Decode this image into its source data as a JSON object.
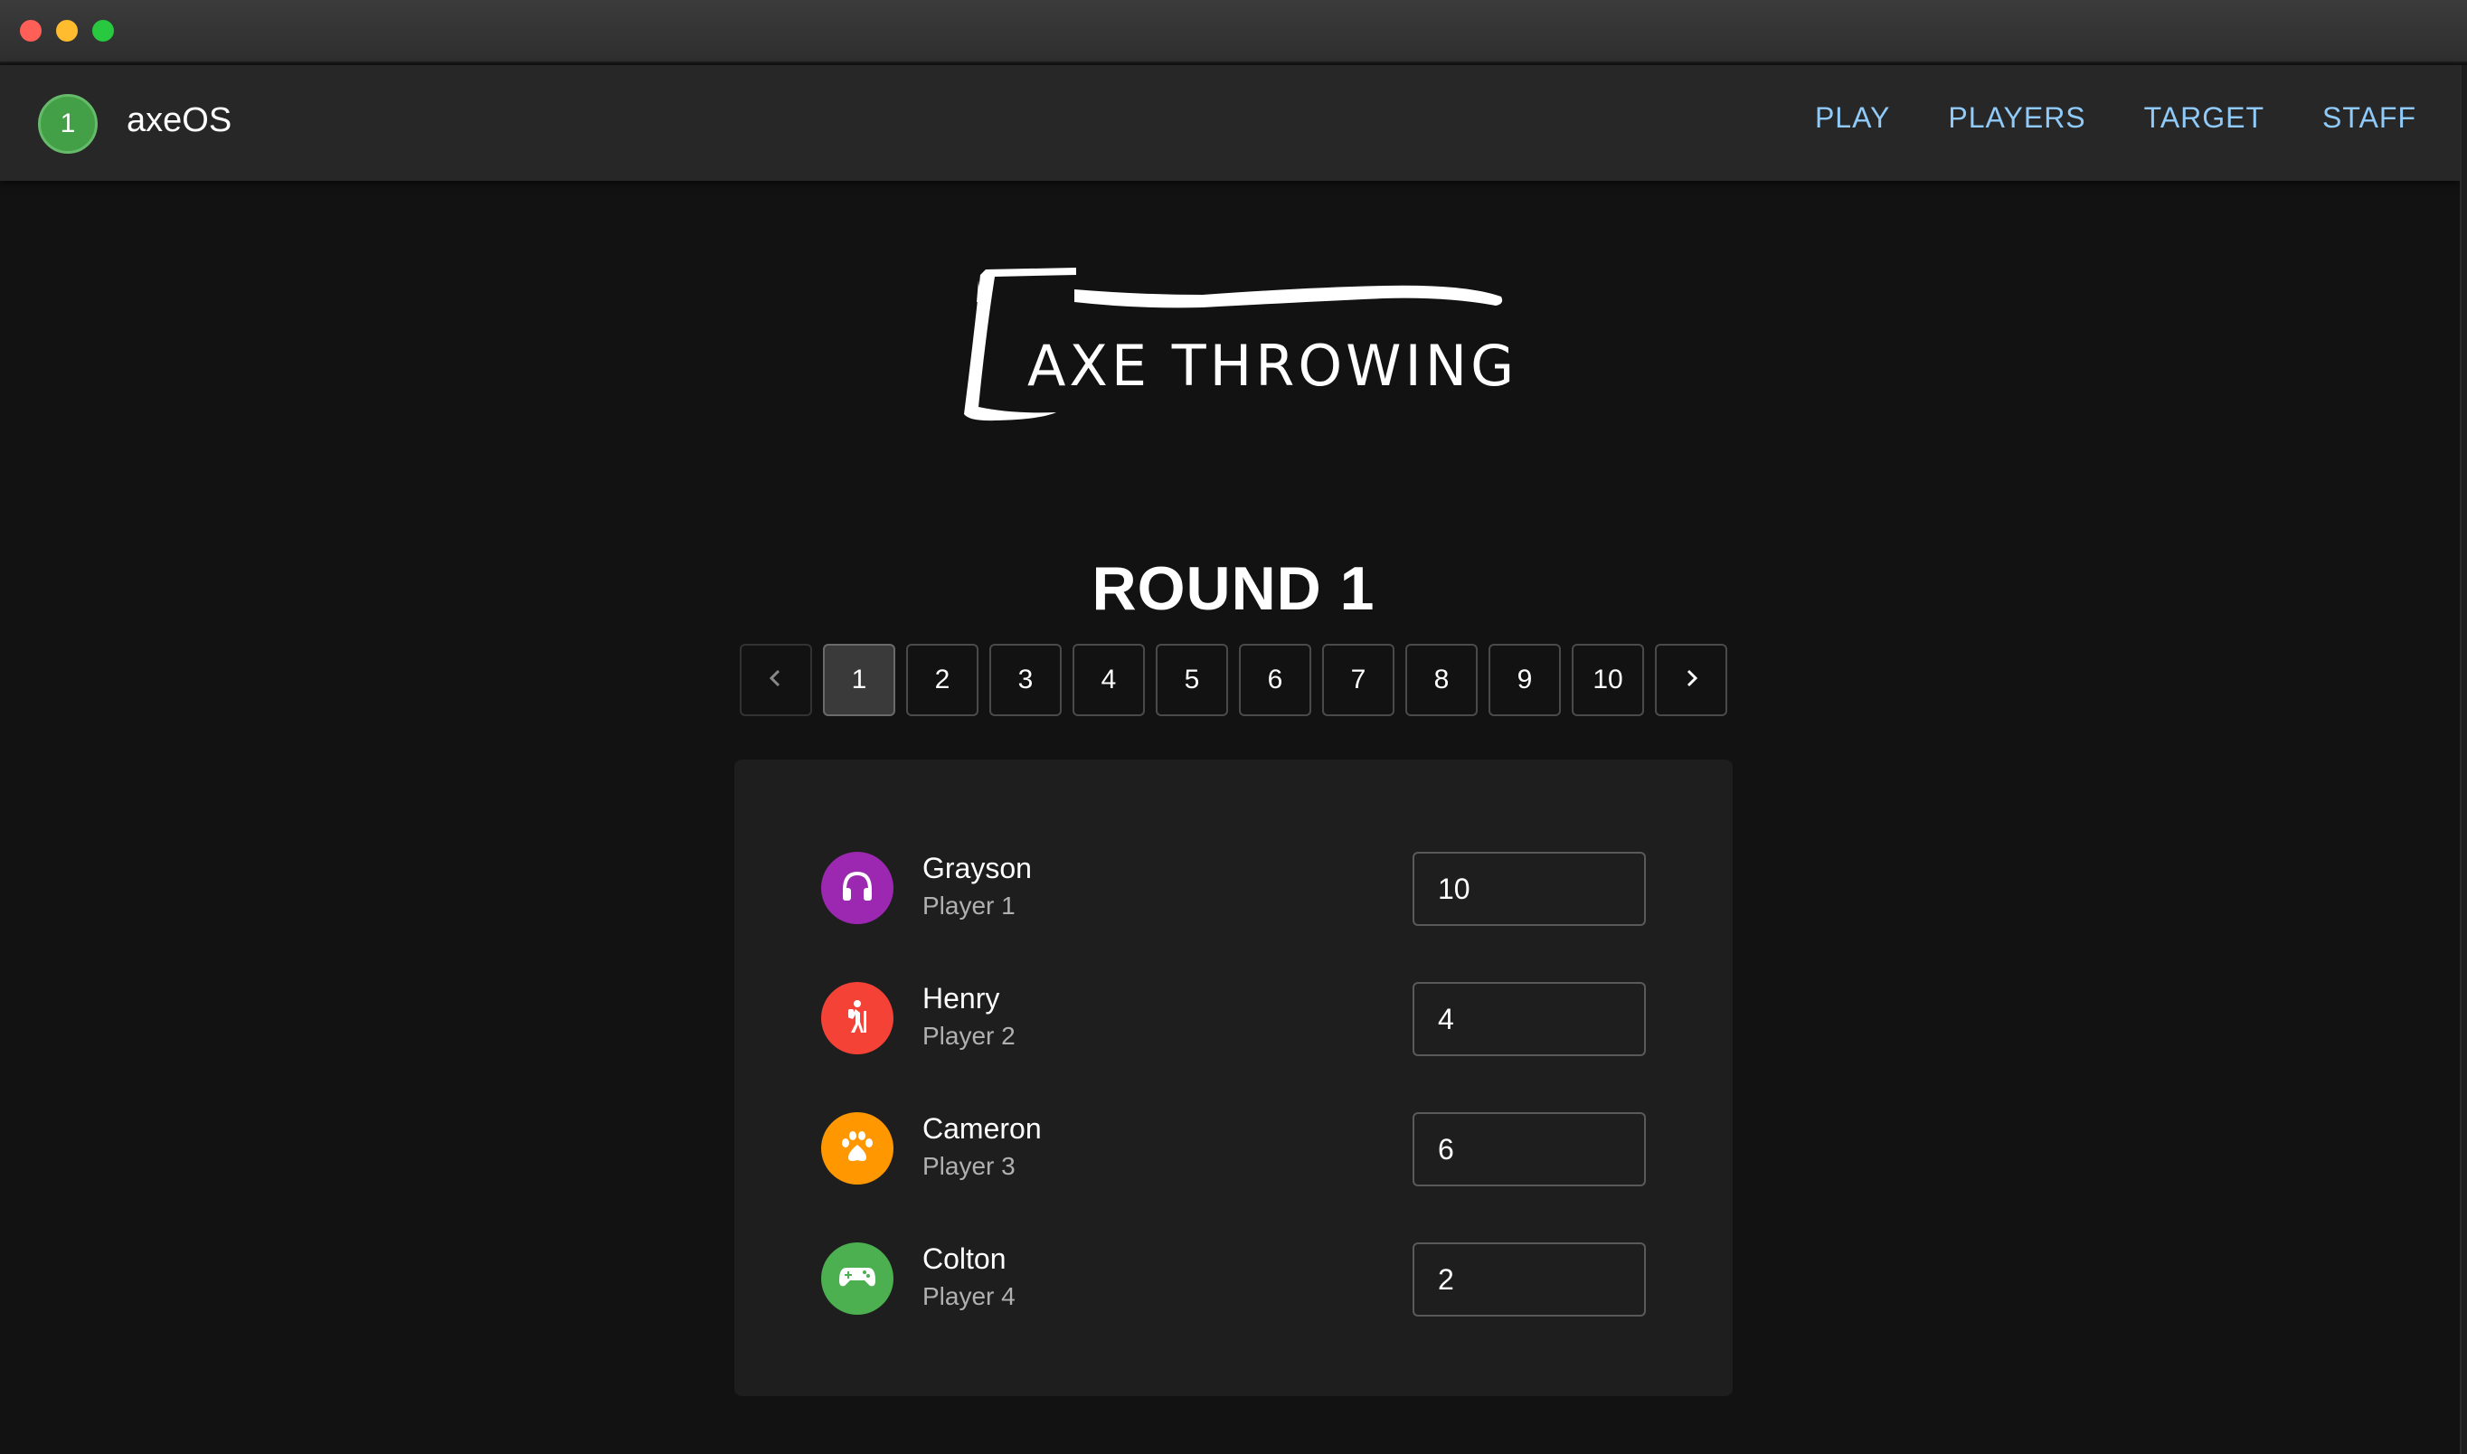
{
  "app": {
    "badge": "1",
    "title": "axeOS"
  },
  "nav": [
    {
      "label": "PLAY"
    },
    {
      "label": "PLAYERS"
    },
    {
      "label": "TARGET"
    },
    {
      "label": "STAFF"
    }
  ],
  "logo": {
    "text": "AXE THROWING"
  },
  "round": {
    "title": "ROUND 1"
  },
  "pagination": {
    "prev_icon": "chevron-left-icon",
    "next_icon": "chevron-right-icon",
    "pages": [
      "1",
      "2",
      "3",
      "4",
      "5",
      "6",
      "7",
      "8",
      "9",
      "10"
    ],
    "active": "1"
  },
  "players": [
    {
      "name": "Grayson",
      "subtitle": "Player 1",
      "score": "10",
      "icon": "headphones-icon",
      "color": "#9c27b0"
    },
    {
      "name": "Henry",
      "subtitle": "Player 2",
      "score": "4",
      "icon": "hiker-icon",
      "color": "#f44336"
    },
    {
      "name": "Cameron",
      "subtitle": "Player 3",
      "score": "6",
      "icon": "paw-icon",
      "color": "#ff9800"
    },
    {
      "name": "Colton",
      "subtitle": "Player 4",
      "score": "2",
      "icon": "gamepad-icon",
      "color": "#4caf50"
    }
  ],
  "colors": {
    "background": "#121212",
    "appbar": "#272727",
    "nav_link": "#90caf9",
    "panel": "#1e1e1e"
  }
}
